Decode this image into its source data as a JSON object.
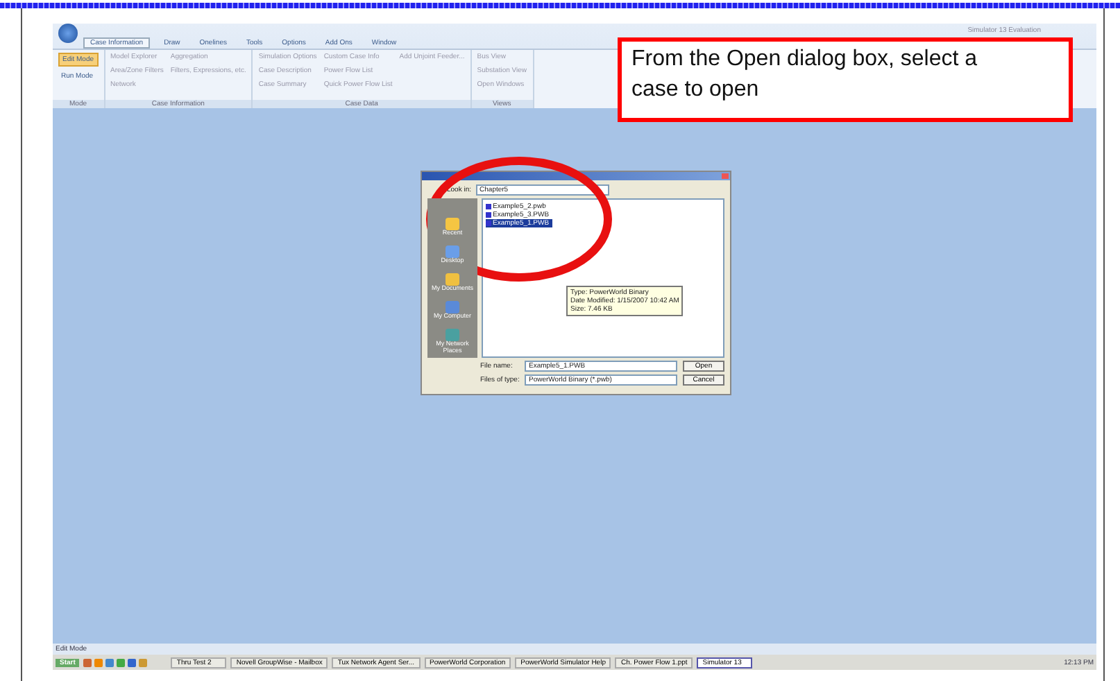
{
  "callout": {
    "text": "From the Open dialog box, select a case to open"
  },
  "app": {
    "title": "Simulator 13 Evaluation",
    "tabs": [
      {
        "label": "Case Information",
        "selected": true
      },
      {
        "label": "Draw",
        "selected": false
      },
      {
        "label": "Onelines",
        "selected": false
      },
      {
        "label": "Tools",
        "selected": false
      },
      {
        "label": "Options",
        "selected": false
      },
      {
        "label": "Add Ons",
        "selected": false
      },
      {
        "label": "Window",
        "selected": false
      }
    ],
    "mode_buttons": [
      {
        "label": "Edit Mode",
        "selected": true
      },
      {
        "label": "Run Mode",
        "selected": false
      }
    ],
    "ribbon_groups": [
      {
        "label": "Mode"
      },
      {
        "label": "Case Information",
        "items": [
          "Model Explorer",
          "Area/Zone Filters",
          "Network",
          "Aggregation",
          "Filters, Expressions, etc."
        ]
      },
      {
        "label": "Case Data",
        "items": [
          "Simulation Options",
          "Case Description",
          "Case Summary",
          "Custom Case Info",
          "Power Flow List",
          "Quick Power Flow List",
          "Add Unjoint Feeder..."
        ]
      },
      {
        "label": "Views",
        "items": [
          "Bus View",
          "Substation View",
          "Open Windows"
        ]
      }
    ],
    "status": "Edit Mode"
  },
  "dialog": {
    "look_in_label": "Look in:",
    "look_in": "Chapter5",
    "places": [
      "Recent",
      "Desktop",
      "My Documents",
      "My Computer",
      "My Network Places"
    ],
    "files": [
      {
        "name": "Example5_2.pwb",
        "selected": false
      },
      {
        "name": "Example5_3.PWB",
        "selected": false
      },
      {
        "name": "Example5_1.PWB",
        "selected": true
      }
    ],
    "tooltip": [
      "Type: PowerWorld Binary",
      "Date Modified: 1/15/2007 10:42 AM",
      "Size: 7.46 KB"
    ],
    "file_name_label": "File name:",
    "file_name": "Example5_1.PWB",
    "file_type_label": "Files of type:",
    "file_type": "PowerWorld Binary (*.pwb)",
    "buttons": [
      "Open",
      "Cancel"
    ]
  },
  "taskbar": {
    "start": "Start",
    "tasks": [
      {
        "label": "Thru Test 2",
        "selected": false
      },
      {
        "label": "Novell GroupWise - Mailbox",
        "selected": false
      },
      {
        "label": "Tux Network Agent Ser...",
        "selected": false
      },
      {
        "label": "PowerWorld Corporation",
        "selected": false
      },
      {
        "label": "PowerWorld Simulator Help",
        "selected": false
      },
      {
        "label": "Ch. Power Flow 1.ppt",
        "selected": false
      },
      {
        "label": "Simulator 13",
        "selected": true
      }
    ],
    "clock": "12:13 PM"
  }
}
